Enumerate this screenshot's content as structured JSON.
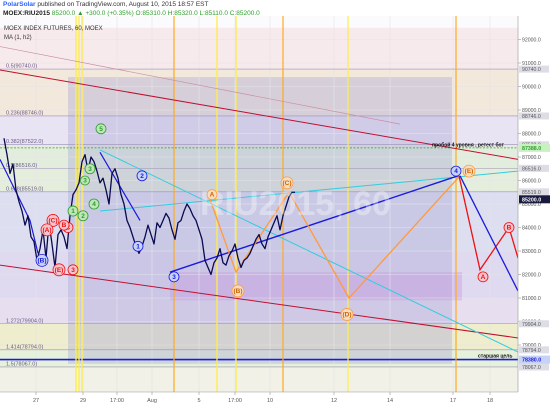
{
  "header": {
    "author": "PolarSolar",
    "published_text": "published on TradingView.com, August 10, 2015 18:57 EST",
    "symbol": "MOEX:RIU2015",
    "quote_text": "85200.0 ▲ +300.0 (+0.35%) O:85310.0 H:85320.0 L:85110.0 C:85200.0"
  },
  "instrument": {
    "title": "MOEX INDEX FUTURES, 60, MOEX",
    "indicator": "MA (1, h2)"
  },
  "watermark": "RIU2015, 60",
  "colors": {
    "price_line": "#0a0a50",
    "primary_count": "#2e9d2e",
    "impulse_line": "#1a1add",
    "orange_path": "#ff9a3c",
    "red_path": "#ee1111",
    "cyan_line": "#33ccdd",
    "channel_line": "#cc1133",
    "vertical_orange": "#ffaa22",
    "vertical_yellow": "#ffee44",
    "wave_circle_fill": "#cfcdf2"
  },
  "chart_data": {
    "type": "line",
    "title": "MOEX INDEX FUTURES, 60, MOEX",
    "ylim": [
      77000,
      93000
    ],
    "x_tick_labels": [
      "27",
      "29",
      "17:00",
      "Aug",
      "5",
      "17:00",
      "10",
      "12",
      "14",
      "17",
      "18"
    ],
    "y_tick_labels": [
      "92000.0",
      "91000.0",
      "90000.0",
      "89000.0",
      "88000.0",
      "87000.0",
      "86000.0",
      "85000.0",
      "84000.0",
      "83000.0",
      "82000.0",
      "81000.0",
      "80000.0",
      "79000.0"
    ],
    "fib_levels": [
      {
        "label": "0.5(90740.0)",
        "value": 90740
      },
      {
        "label": "0.236(88746.0)",
        "value": 88746
      },
      {
        "label": "0.382(87522.0)",
        "value": 87522
      },
      {
        "label": "0.5(86516.0)",
        "value": 86516
      },
      {
        "label": "0.618(85519.0)",
        "value": 85519
      },
      {
        "label": "1.272(79904.0)",
        "value": 79904
      },
      {
        "label": "1.414(78794.0)",
        "value": 78794
      },
      {
        "label": "1.5(78067.0)",
        "value": 78067
      }
    ],
    "price_labels": [
      {
        "text": "87388.0",
        "value": 87388,
        "color": "#2e9d2e"
      },
      {
        "text": "85200.0",
        "value": 85200,
        "color": "#ffffff"
      },
      {
        "text": "78380.0",
        "value": 78380,
        "color": "#1a1add"
      }
    ],
    "annotations": [
      {
        "text": "пробой 4 уровня , ретест бот",
        "value": 87388
      },
      {
        "text": "старшая цель",
        "value": 78380
      }
    ],
    "series": [
      {
        "x": [
          0,
          3,
          6,
          9,
          12,
          15,
          18,
          21,
          24,
          27,
          30,
          33,
          36,
          39,
          42,
          45,
          48,
          51,
          54,
          57,
          60,
          63,
          66,
          69,
          72,
          75,
          78,
          81,
          84,
          87,
          90,
          93,
          96,
          99,
          102,
          105,
          108,
          111,
          114,
          117,
          120,
          123,
          126,
          129,
          132,
          135,
          138,
          141,
          144,
          147,
          150,
          153,
          156,
          159,
          162,
          165,
          168,
          171,
          174,
          177,
          180,
          183,
          186,
          189,
          192,
          195,
          198,
          201,
          204,
          207,
          210,
          213,
          216,
          219,
          222,
          225,
          228,
          231,
          234,
          237,
          240,
          243,
          246,
          249,
          252,
          255,
          258,
          261,
          264,
          267,
          270,
          273,
          276,
          279,
          282,
          285,
          288,
          291
        ],
        "values": [
          87800,
          87100,
          86300,
          86700,
          85600,
          85100,
          84700,
          84100,
          84500,
          83600,
          83400,
          82600,
          83100,
          83900,
          82700,
          84200,
          83300,
          82300,
          83700,
          83900,
          83600,
          83100,
          84500,
          85400,
          85600,
          85900,
          86800,
          87100,
          86400,
          87000,
          86800,
          86400,
          85900,
          86100,
          85600,
          85000,
          86300,
          86500,
          86100,
          85400,
          85000,
          84300,
          84000,
          83600,
          83200,
          82900,
          83200,
          83600,
          84100,
          83700,
          83300,
          84200,
          84000,
          84300,
          84600,
          84400,
          83900,
          83500,
          84200,
          84300,
          84700,
          85000,
          84800,
          84500,
          84300,
          83900,
          83500,
          82600,
          82300,
          82000,
          82500,
          82700,
          83100,
          82500,
          82400,
          82800,
          83000,
          83300,
          82700,
          82300,
          82600,
          82700,
          82900,
          83200,
          83500,
          83700,
          83300,
          83100,
          83600,
          83900,
          84200,
          84500,
          83900,
          84500,
          84900,
          85300,
          85500,
          85500
        ]
      }
    ],
    "wave_labels_primary": [
      "1",
      "2",
      "3",
      "4",
      "5",
      "A",
      "B",
      "C"
    ],
    "wave_labels_secondary": [
      "1",
      "2",
      "3",
      "4",
      "5"
    ],
    "wave_labels_corrective": [
      "(A)",
      "(B)",
      "(C)",
      "(D)",
      "(E)",
      "A",
      "B",
      "C",
      "4"
    ]
  }
}
